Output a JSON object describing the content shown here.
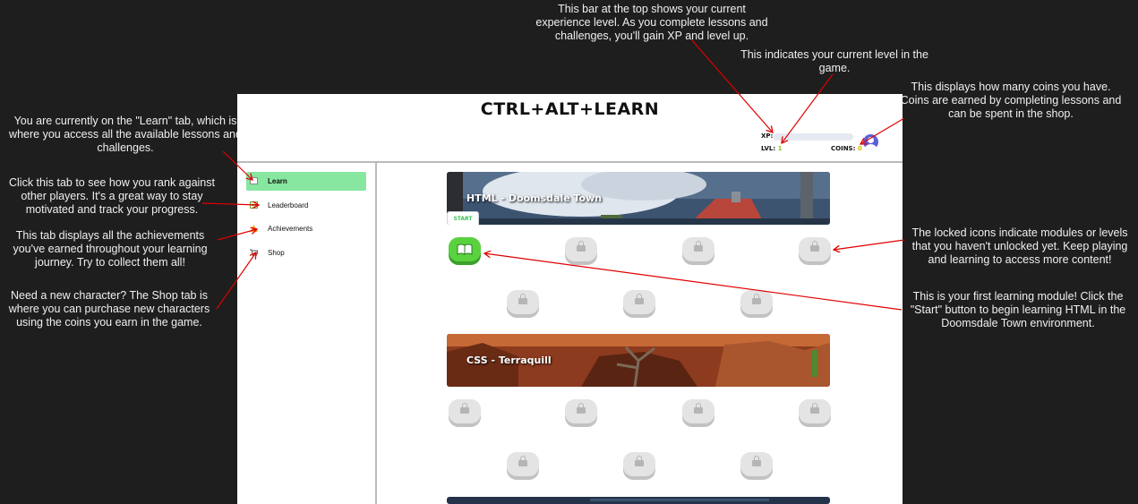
{
  "app": {
    "title": "CTRL+ALT+LEARN",
    "xp_label": "XP:",
    "level_label": "LVL:",
    "level_value": "1",
    "coins_label": "COINS:",
    "coins_value": "0",
    "xp_progress": 0
  },
  "sidebar": {
    "items": [
      {
        "label": "Learn",
        "icon": "book-icon",
        "active": true
      },
      {
        "label": "Leaderboard",
        "icon": "leaderboard-icon",
        "active": false
      },
      {
        "label": "Achievements",
        "icon": "trophy-icon",
        "active": false
      },
      {
        "label": "Shop",
        "icon": "cart-icon",
        "active": false
      }
    ]
  },
  "modules": [
    {
      "title": "HTML - Doomsdale Town",
      "start_label": "START",
      "first_node": "book-icon",
      "locked_nodes": 6
    },
    {
      "title": "CSS - Terraquill",
      "locked_nodes": 7
    }
  ],
  "annotations": {
    "xp_bar": "This bar at the top shows your current experience level.  As you complete lessons and challenges, you'll gain XP and level up.",
    "level": "This indicates your current level in the game.",
    "coins": "This displays how many coins you have. Coins are earned by completing lessons and can be spent in the shop.",
    "learn_tab": "You are currently on the \"Learn\" tab, which is where you access all the available lessons and challenges.",
    "leaderboard_tab": "Click this tab to see how you rank against other players.  It's a great way to stay motivated and track your progress.",
    "achievements_tab": "This tab displays all the achievements you've earned throughout your learning journey.  Try to collect them all!",
    "shop_tab": "Need a new character? The Shop tab is where you can purchase new characters using the coins you earn in the game.",
    "locked_icons": "The locked icons indicate modules or levels that you haven't unlocked yet. Keep playing and learning to access more content!",
    "first_module": "This is your first learning module! Click the \"Start\" button to begin learning HTML in the Doomsdale Town environment."
  },
  "colors": {
    "accent_green": "#5ad13f",
    "active_tab": "#87e6a0",
    "annotation_line": "#e00000",
    "avatar": "#5b5fd6"
  }
}
